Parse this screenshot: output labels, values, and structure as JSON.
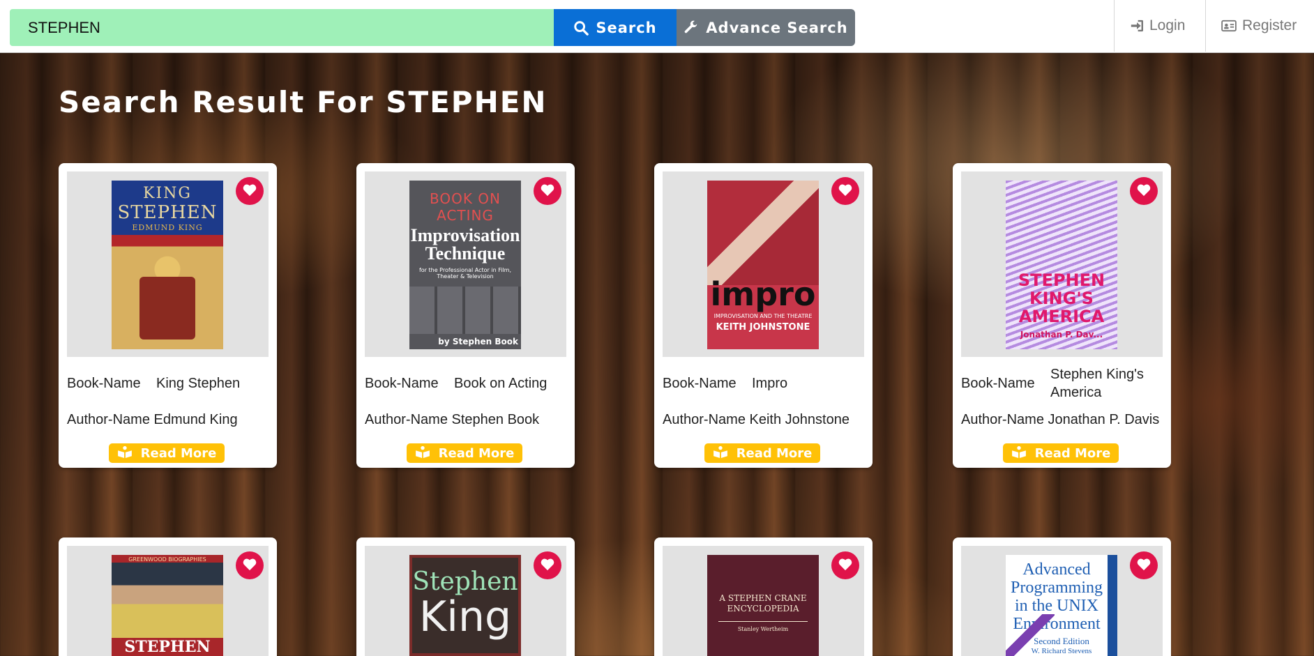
{
  "header": {
    "search_value": "STEPHEN",
    "search_button": "Search",
    "advance_button": "Advance Search",
    "login": "Login",
    "register": "Register"
  },
  "main": {
    "title": "Search Result For STEPHEN",
    "book_name_label": "Book-Name",
    "author_name_label": "Author-Name",
    "read_more_label": "Read More",
    "books": [
      {
        "name": "King Stephen",
        "author": "Edmund King",
        "cover": {
          "t1": "KING",
          "t2": "STEPHEN",
          "t3": "EDMUND KING"
        }
      },
      {
        "name": "Book on Acting",
        "author": "Stephen Book",
        "cover": {
          "t1": "BOOK ON ACTING",
          "t2": "Improvisation Technique",
          "t3": "for the Professional Actor in Film, Theater & Television",
          "t4": "by Stephen Book"
        }
      },
      {
        "name": "Impro",
        "author": "Keith Johnstone",
        "cover": {
          "t1": "impro",
          "t2": "IMPROVISATION AND THE THEATRE",
          "t3": "KEITH JOHNSTONE"
        }
      },
      {
        "name": "Stephen King's America",
        "author": "Jonathan P. Davis",
        "cover": {
          "t1": "STEPHEN KING'S AMERICA",
          "t2": "Jonathan P. Dav..."
        }
      },
      {
        "cover": {
          "t0": "GREENWOOD BIOGRAPHIES",
          "t1": "STEPHEN"
        }
      },
      {
        "cover": {
          "t1": "Stephen",
          "t2": "King"
        }
      },
      {
        "cover": {
          "t1": "A STEPHEN CRANE ENCYCLOPEDIA",
          "t2": "Stanley Wertheim"
        }
      },
      {
        "cover": {
          "t1": "Advanced Programming in the UNIX Environment",
          "t2": "Second Edition",
          "t3": "W. Richard Stevens"
        }
      }
    ]
  },
  "colors": {
    "search_bg": "#9ff0b8",
    "search_btn": "#0a6fd6",
    "advance_btn": "#6c757d",
    "heart": "#e0134a",
    "read_more": "#ffc107"
  },
  "icons": {
    "search": "search-icon",
    "advance": "wrench-icon",
    "login": "sign-in-icon",
    "register": "id-card-icon",
    "favorite": "heart-icon",
    "read_more": "book-reader-icon"
  }
}
